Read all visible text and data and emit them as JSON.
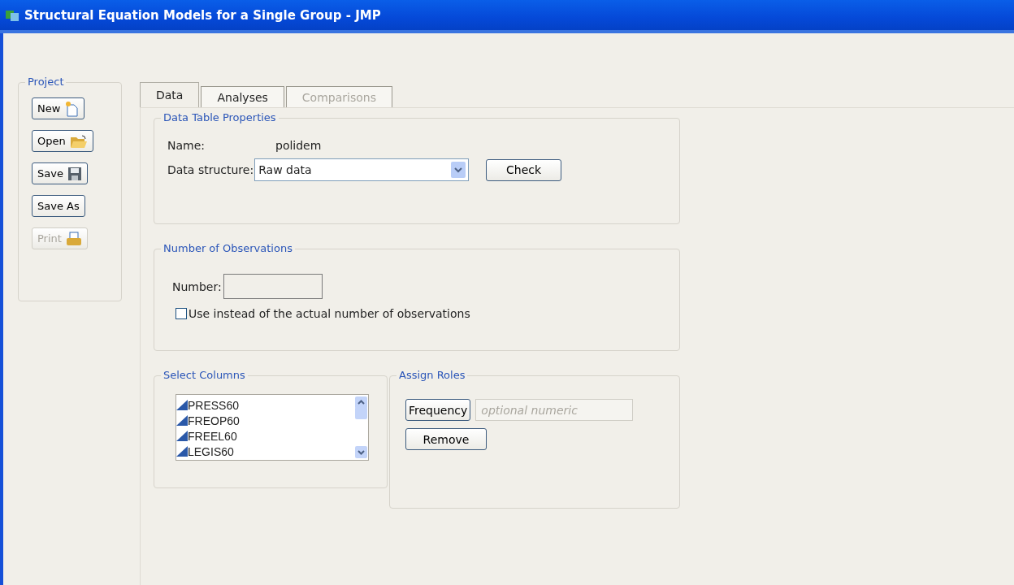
{
  "window": {
    "title": "Structural Equation Models for a Single Group - JMP"
  },
  "project": {
    "title": "Project",
    "buttons": [
      {
        "label": "New",
        "kind": "new",
        "disabled": false
      },
      {
        "label": "Open",
        "kind": "open",
        "disabled": false
      },
      {
        "label": "Save",
        "kind": "save",
        "disabled": false
      },
      {
        "label": "Save As",
        "kind": "none",
        "disabled": false
      },
      {
        "label": "Print",
        "kind": "print",
        "disabled": true
      }
    ]
  },
  "tabs": [
    {
      "label": "Data",
      "selected": true,
      "disabled": false
    },
    {
      "label": "Analyses",
      "selected": false,
      "disabled": false
    },
    {
      "label": "Comparisons",
      "selected": false,
      "disabled": true
    }
  ],
  "data_table_properties": {
    "title": "Data Table Properties",
    "name_label": "Name:",
    "name_value": "polidem",
    "structure_label": "Data structure:",
    "structure_value": "Raw data",
    "check_button": "Check"
  },
  "number_of_observations": {
    "title": "Number of Observations",
    "number_label": "Number:",
    "checkbox": {
      "label": "Use instead of the actual number of observations",
      "checked": false
    }
  },
  "select_columns": {
    "title": "Select Columns",
    "items": [
      "PRESS60",
      "FREOP60",
      "FREEL60",
      "LEGIS60"
    ]
  },
  "assign_roles": {
    "title": "Assign Roles",
    "frequency_button": "Frequency",
    "frequency_placeholder": "optional numeric",
    "remove_button": "Remove"
  }
}
